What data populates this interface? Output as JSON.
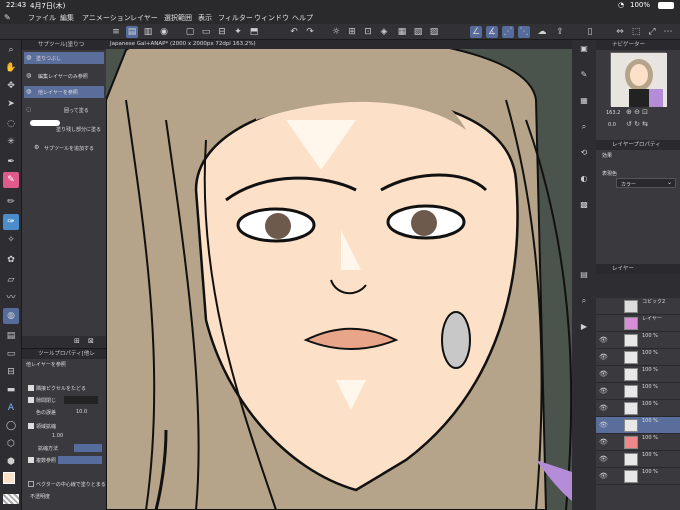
{
  "status": {
    "time": "22:43",
    "date": "4月7日(木)",
    "battery": "100%"
  },
  "menu": [
    "ファイル",
    "編集",
    "アニメーション",
    "レイヤー",
    "選択範囲",
    "表示",
    "フィルター",
    "ウィンドウ",
    "ヘルプ"
  ],
  "document": {
    "title": "Japanese Gal+ANAP* (2000 x 2000px 72dpi 163.2%)"
  },
  "subtool": {
    "header": "サブツール[塗りつ",
    "items": [
      "塗りつぶし",
      "編集レイヤーのみ参照",
      "他レイヤーを参照",
      "囲って塗る",
      "塗り残し部分に塗る"
    ],
    "add_label": "サブツールを追加する"
  },
  "tool_property": {
    "header": "ツールプロパティ[他レ",
    "subtitle": "他レイヤーを参照",
    "rows": [
      {
        "label": "隣接ピクセルをたどる",
        "value": ""
      },
      {
        "label": "隙間閉じ",
        "value": ""
      },
      {
        "label": "色の誤差",
        "value": "10.0"
      },
      {
        "label": "領域拡縮",
        "value": "1.00"
      },
      {
        "label": "拡縮方法",
        "value": ""
      },
      {
        "label": "複数参照",
        "value": ""
      },
      {
        "label": "ベクターの中心線で塗りとまる",
        "value": ""
      },
      {
        "label": "不透明度",
        "value": ""
      }
    ]
  },
  "navigator": {
    "header": "ナビゲーター",
    "zoom": "163.2",
    "angle": "0.0"
  },
  "layer_property": {
    "header": "レイヤープロパティ",
    "effect": "効果",
    "display_color": "表現色",
    "color_value": "カラー"
  },
  "layers": {
    "header": "レイヤー",
    "items": [
      {
        "name": "コピック2",
        "opacity": ""
      },
      {
        "name": "レイヤー",
        "opacity": "100 %"
      },
      {
        "name": "レイヤー",
        "opacity": "100 %"
      },
      {
        "name": "レイヤー",
        "opacity": "100 %"
      },
      {
        "name": "レイヤー",
        "opacity": "100 %"
      },
      {
        "name": "レイヤー",
        "opacity": "100 %"
      },
      {
        "name": "レイヤー",
        "opacity": "100 %"
      },
      {
        "name": "レイヤー",
        "opacity": "100 %"
      },
      {
        "name": "レイヤー",
        "opacity": "100 %"
      },
      {
        "name": "レイヤー",
        "opacity": "100 %"
      },
      {
        "name": "レイヤー",
        "opacity": "100 %"
      }
    ]
  },
  "colors": {
    "accent": "#556c9c",
    "canvas_bg": "#4a544c",
    "skin": "#fde0c8",
    "hair": "#b5a48a"
  }
}
